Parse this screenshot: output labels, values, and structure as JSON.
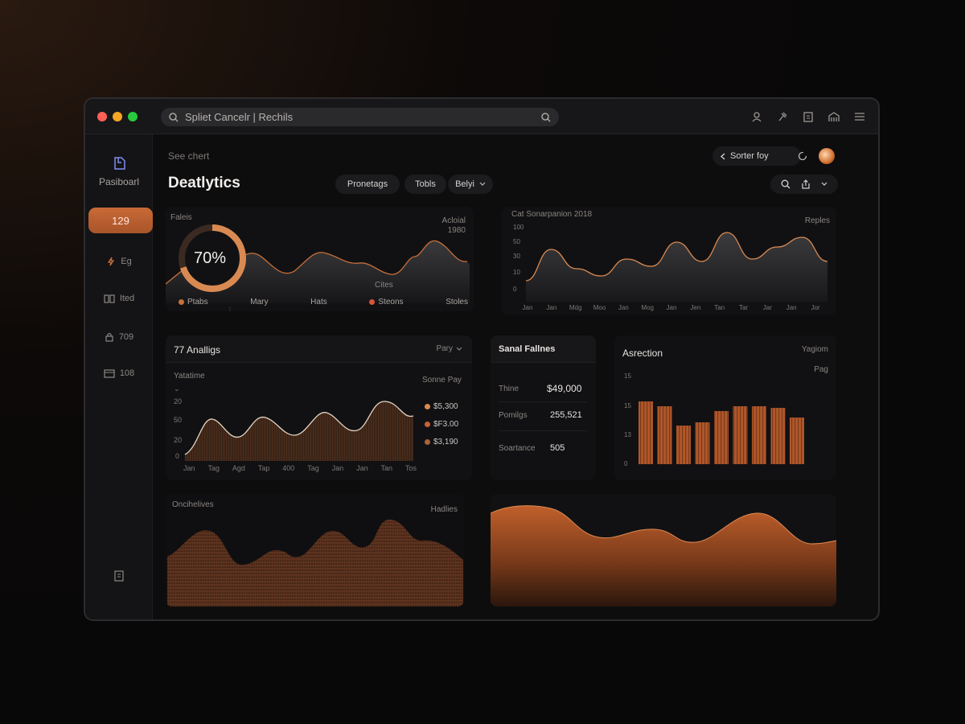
{
  "titlebar": {
    "search_text": "Spliet Cancelr | Rechils",
    "icons": [
      "user-icon",
      "pin-icon",
      "clipboard-icon",
      "building-icon",
      "menu-icon"
    ]
  },
  "sidebar": {
    "logo_label": "Pasiboarl",
    "active_label": "129",
    "items": [
      {
        "icon": "lightning-icon",
        "label": "Eg"
      },
      {
        "icon": "files-icon",
        "label": "Ited"
      },
      {
        "icon": "lock-icon",
        "label": "709"
      },
      {
        "icon": "window-icon",
        "label": "108"
      }
    ],
    "bottom_icon": "document-icon"
  },
  "header": {
    "subtitle": "See chert",
    "title": "Deatlytics",
    "pills": [
      "Pronetags",
      "Tobls",
      "Belyi"
    ],
    "back_label": "Sorter foy"
  },
  "colors": {
    "accent": "#c8703a",
    "accent_dark": "#7a3c1c",
    "bg": "#0d0d0e",
    "card": "#121214"
  },
  "card1": {
    "label": "Faleis",
    "right_label": "Acloial",
    "right_value": "1980",
    "gauge_text": "70%",
    "gauge_value": 0.7,
    "inner_label": "Cites",
    "legend": [
      "Ptabs",
      "Mary",
      "Hats",
      "Steons",
      "Stoles"
    ]
  },
  "card2": {
    "title": "Cat Sonarpanion 2018",
    "right_label": "Reples",
    "y_ticks": [
      "100",
      "50",
      "30",
      "10",
      "0"
    ],
    "x_ticks": [
      "Jan",
      "Jan",
      "Mdg",
      "Moo",
      "Jan",
      "Mog",
      "Jan",
      "Jen",
      "Tan",
      "Tar",
      "Jar",
      "Jan",
      "Jor"
    ]
  },
  "card3": {
    "title": "77 Analligs",
    "dropdown": "Pary",
    "left_label": "Yatatime",
    "right_label": "Sonne Pay",
    "y_ticks": [
      "20",
      "50",
      "20",
      "0"
    ],
    "x_ticks": [
      "Jan",
      "Tag",
      "Agd",
      "Tap",
      "400",
      "Tag",
      "Jan",
      "Jan",
      "Tan",
      "Tos"
    ],
    "legend": [
      "$5,300",
      "$F3.00",
      "$3,190"
    ]
  },
  "card4": {
    "title": "Sanal Fallnes",
    "rows": [
      {
        "label": "Thine",
        "value": "$49,000"
      },
      {
        "label": "Pomilgs",
        "value": "255,521"
      },
      {
        "label": "Soartance",
        "value": "505"
      }
    ]
  },
  "card5": {
    "title": "Asrection",
    "right_label": "Yagiom",
    "right_sub": "Pag",
    "y_ticks": [
      "15",
      "15",
      "13",
      "0"
    ]
  },
  "card6": {
    "left_label": "Oncihelives",
    "right_label": "Hadlies"
  },
  "chart_data": [
    {
      "type": "area",
      "title": "Cat Sonarpanion 2018",
      "x": [
        "Jan",
        "Jan",
        "Mdg",
        "Moo",
        "Jan",
        "Mog",
        "Jan",
        "Jen",
        "Tan",
        "Tar",
        "Jar",
        "Jan",
        "Jor"
      ],
      "y_ticks": [
        "100",
        "50",
        "30",
        "10",
        "0"
      ],
      "series": [
        {
          "values": [
            12,
            38,
            22,
            16,
            30,
            24,
            44,
            28,
            52,
            30,
            40,
            48,
            28
          ]
        }
      ]
    },
    {
      "type": "bar",
      "title": "Asrection",
      "values": [
        78,
        72,
        48,
        52,
        66,
        72,
        72,
        70,
        58
      ]
    }
  ]
}
